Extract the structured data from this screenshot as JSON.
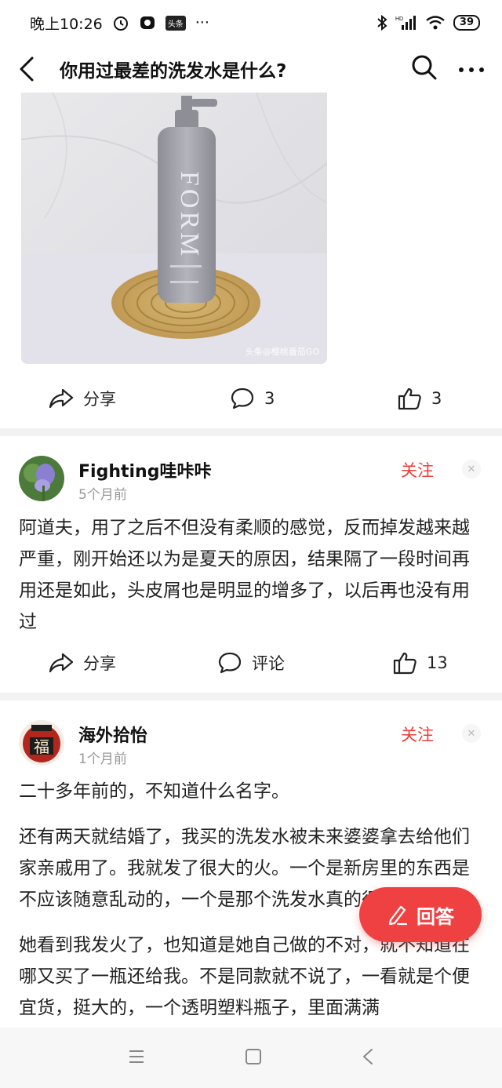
{
  "status_bar": {
    "time": "晚上10:26",
    "toutiao_badge": "头条",
    "more": "···",
    "battery": "39",
    "network": "HD"
  },
  "header": {
    "title": "你用过最差的洗发水是什么?"
  },
  "post": {
    "image_caption": "头条@樱桃番茄GO",
    "image_brand_text": "FORM",
    "share_label": "分享",
    "comment_count": "3",
    "like_count": "3"
  },
  "answers": [
    {
      "username": "Fighting哇咔咔",
      "time": "5个月前",
      "follow_label": "关注",
      "paragraphs": [
        "阿道夫，用了之后不但没有柔顺的感觉，反而掉发越来越严重，刚开始还以为是夏天的原因，结果隔了一段时间再用还是如此，头皮屑也是明显的增多了，以后再也没有用过"
      ],
      "share_label": "分享",
      "comment_label": "评论",
      "like_count": "13"
    },
    {
      "username": "海外拾怡",
      "time": "1个月前",
      "follow_label": "关注",
      "avatar_text": "福",
      "paragraphs": [
        "二十多年前的，不知道什么名字。",
        "还有两天就结婚了，我买的洗发水被未来婆婆拿去给他们家亲戚用了。我就发了很大的火。一个是新房里的东西是不应该随意乱动的，一个是那个洗发水真的很贵。",
        "她看到我发火了，也知道是她自己做的不对，就不知道在哪又买了一瓶还给我。不是同款就不说了，一看就是个便宜货，挺大的，一个透明塑料瓶子，里面满满"
      ]
    }
  ],
  "answer_button": {
    "label": "回答"
  }
}
